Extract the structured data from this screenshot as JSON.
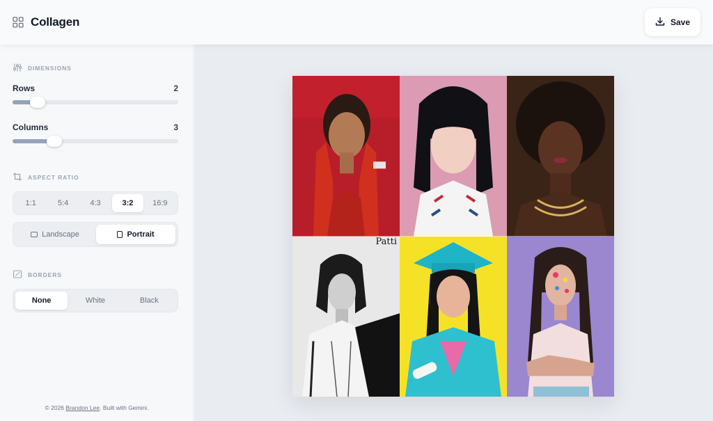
{
  "header": {
    "title": "Collagen",
    "save_label": "Save"
  },
  "sidebar": {
    "dimensions": {
      "title": "DIMENSIONS",
      "rows_label": "Rows",
      "rows_value": "2",
      "rows_fraction": 0.15,
      "columns_label": "Columns",
      "columns_value": "3",
      "columns_fraction": 0.25
    },
    "aspect_ratio": {
      "title": "ASPECT RATIO",
      "options": [
        "1:1",
        "5:4",
        "4:3",
        "3:2",
        "16:9"
      ],
      "selected": "3:2",
      "orientation_options": [
        "Landscape",
        "Portrait"
      ],
      "orientation_selected": "Portrait"
    },
    "borders": {
      "title": "BORDERS",
      "options": [
        "None",
        "White",
        "Black"
      ],
      "selected": "None"
    }
  },
  "footer": {
    "prefix": "© 2026 ",
    "author": "Brandon Lee",
    "suffix": ". Built with Gemini."
  },
  "collage": {
    "caption": "Patti",
    "photos": [
      {
        "name": "photo-red-gloves",
        "bg": "#b81d2a"
      },
      {
        "name": "photo-pink-portrait",
        "bg": "#e0a3b6"
      },
      {
        "name": "photo-gold-necklace",
        "bg": "#3a2317"
      },
      {
        "name": "photo-black-white",
        "bg": "#e8e8e8"
      },
      {
        "name": "photo-graduation",
        "bg": "#f5e227"
      },
      {
        "name": "photo-purple-stickers",
        "bg": "#9b86d0"
      }
    ]
  },
  "colors": {
    "accent": "#94a3b8",
    "text": "#111827",
    "muted": "#9aa3b2"
  }
}
